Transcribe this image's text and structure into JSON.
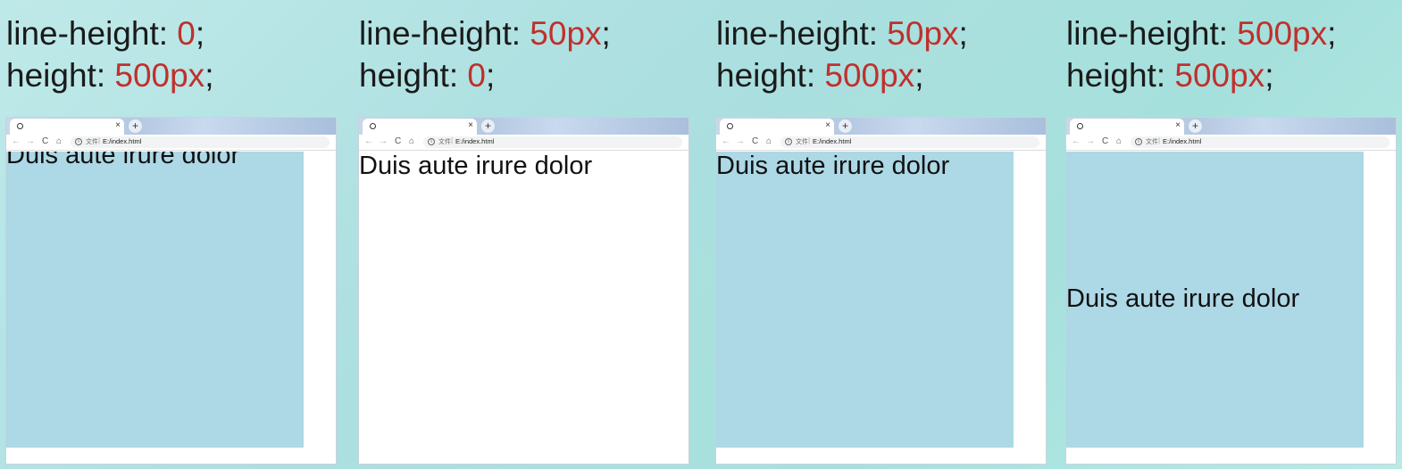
{
  "colors": {
    "highlight": "#c0302c",
    "box_background": "#add8e6",
    "page_background": "#b3e3e2"
  },
  "browser": {
    "tab_title": "",
    "favicon": "globe-icon",
    "close_label": "×",
    "newtab_label": "+",
    "nav": {
      "back": "←",
      "forward": "→",
      "reload": "C",
      "home": "⌂"
    },
    "protocol_label": "文件",
    "separator": "|",
    "url": "E:/index.html"
  },
  "sample_text": "Duis aute irure dolor",
  "panels": [
    {
      "prop1": "line-height",
      "val1": "0",
      "prop2": "height",
      "val2": "500px",
      "show_box": true
    },
    {
      "prop1": "line-height",
      "val1": "50px",
      "prop2": "height",
      "val2": "0",
      "show_box": false
    },
    {
      "prop1": "line-height",
      "val1": "50px",
      "prop2": "height",
      "val2": "500px",
      "show_box": true
    },
    {
      "prop1": "line-height",
      "val1": "500px",
      "prop2": "height",
      "val2": "500px",
      "show_box": true
    }
  ]
}
